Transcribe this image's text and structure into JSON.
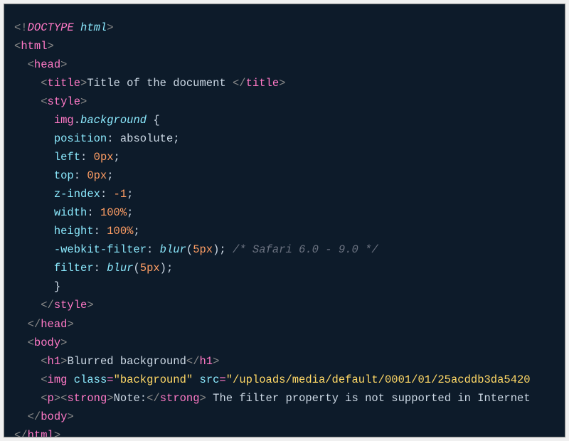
{
  "code": {
    "l1": {
      "open": "<!",
      "doctype": "DOCTYPE",
      "space": " ",
      "html": "html",
      "close": ">"
    },
    "l2": {
      "open": "<",
      "tag": "html",
      "close": ">"
    },
    "l3": {
      "indent": "  ",
      "open": "<",
      "tag": "head",
      "close": ">"
    },
    "l4": {
      "indent": "    ",
      "open": "<",
      "tag": "title",
      "close": ">",
      "text": "Title of the document ",
      "open2": "</",
      "tag2": "title",
      "close2": ">"
    },
    "l5": {
      "indent": "    ",
      "open": "<",
      "tag": "style",
      "close": ">"
    },
    "l6": {
      "indent": "      ",
      "sel_el": "img",
      "dot": ".",
      "sel_cls": "background",
      "sp": " ",
      "brace": "{"
    },
    "l7": {
      "indent": "      ",
      "prop": "position",
      "colon": ": ",
      "val": "absolute",
      "semi": ";"
    },
    "l8": {
      "indent": "      ",
      "prop": "left",
      "colon": ": ",
      "val": "0px",
      "semi": ";"
    },
    "l9": {
      "indent": "      ",
      "prop": "top",
      "colon": ": ",
      "val": "0px",
      "semi": ";"
    },
    "l10": {
      "indent": "      ",
      "prop": "z-index",
      "colon": ": ",
      "val": "-1",
      "semi": ";"
    },
    "l11": {
      "indent": "      ",
      "prop": "width",
      "colon": ": ",
      "val": "100%",
      "semi": ";"
    },
    "l12": {
      "indent": "      ",
      "prop": "height",
      "colon": ": ",
      "val": "100%",
      "semi": ";"
    },
    "l13": {
      "indent": "      ",
      "prop": "-webkit-filter",
      "colon": ": ",
      "func": "blur",
      "p1": "(",
      "arg": "5px",
      "p2": ")",
      "semi": ";",
      "sp": " ",
      "comment": "/* Safari 6.0 - 9.0 */"
    },
    "l14": {
      "indent": "      ",
      "prop": "filter",
      "colon": ": ",
      "func": "blur",
      "p1": "(",
      "arg": "5px",
      "p2": ")",
      "semi": ";"
    },
    "l15": {
      "indent": "      ",
      "brace": "}"
    },
    "l16": {
      "indent": "    ",
      "open": "</",
      "tag": "style",
      "close": ">"
    },
    "l17": {
      "indent": "  ",
      "open": "</",
      "tag": "head",
      "close": ">"
    },
    "l18": {
      "indent": "  ",
      "open": "<",
      "tag": "body",
      "close": ">"
    },
    "l19": {
      "indent": "    ",
      "open": "<",
      "tag": "h1",
      "close": ">",
      "text": "Blurred background",
      "open2": "</",
      "tag2": "h1",
      "close2": ">"
    },
    "l20": {
      "indent": "    ",
      "open": "<",
      "tag": "img",
      "sp1": " ",
      "attr1": "class",
      "eq1": "=",
      "val1": "\"background\"",
      "sp2": " ",
      "attr2": "src",
      "eq2": "=",
      "val2": "\"/uploads/media/default/0001/01/25acddb3da5420"
    },
    "l21": {
      "indent": "    ",
      "open": "<",
      "tag": "p",
      "close": ">",
      "open2": "<",
      "tag2": "strong",
      "close2": ">",
      "text1": "Note:",
      "open3": "</",
      "tag3": "strong",
      "close3": ">",
      "text2": " The filter property is not supported in Internet"
    },
    "l22": {
      "indent": "  ",
      "open": "</",
      "tag": "body",
      "close": ">"
    },
    "l23": {
      "open": "</",
      "tag": "html",
      "close": ">"
    }
  }
}
